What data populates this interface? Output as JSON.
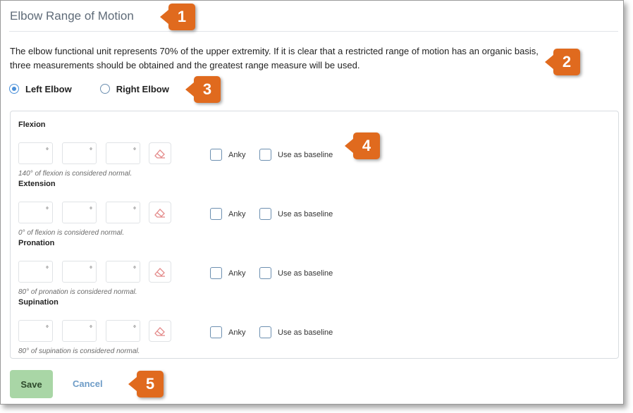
{
  "title": "Elbow Range of Motion",
  "description": "The elbow functional unit represents 70% of the upper extremity. If it is clear that a restricted range of motion has an organic basis, three measurements should be obtained and the greatest range measure will be used.",
  "side": {
    "options": [
      {
        "label": "Left Elbow",
        "selected": true
      },
      {
        "label": "Right Elbow",
        "selected": false
      }
    ]
  },
  "degree_symbol": "°",
  "measurements": [
    {
      "label": "Flexion",
      "hint": "140° of flexion is considered normal.",
      "values": [
        "",
        "",
        ""
      ],
      "anky_label": "Anky",
      "baseline_label": "Use as baseline"
    },
    {
      "label": "Extension",
      "hint": "0° of flexion is considered normal.",
      "values": [
        "",
        "",
        ""
      ],
      "anky_label": "Anky",
      "baseline_label": "Use as baseline"
    },
    {
      "label": "Pronation",
      "hint": "80° of pronation is considered normal.",
      "values": [
        "",
        "",
        ""
      ],
      "anky_label": "Anky",
      "baseline_label": "Use as baseline"
    },
    {
      "label": "Supination",
      "hint": "80° of supination is considered normal.",
      "values": [
        "",
        "",
        ""
      ],
      "anky_label": "Anky",
      "baseline_label": "Use as baseline"
    }
  ],
  "actions": {
    "save_label": "Save",
    "cancel_label": "Cancel"
  },
  "callouts": [
    "1",
    "2",
    "3",
    "4",
    "5"
  ],
  "colors": {
    "accent": "#4a90d9",
    "save_bg": "#a9d6a6",
    "callout": "#e06a1e",
    "link": "#6e9cc7"
  }
}
